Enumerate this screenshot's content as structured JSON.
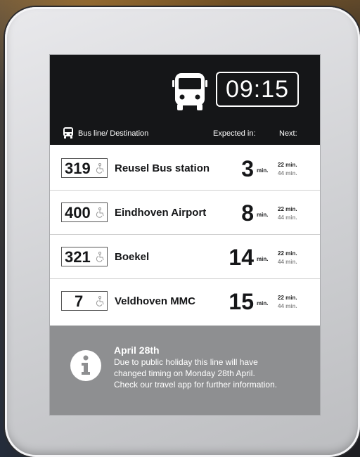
{
  "display": {
    "time": "09:15",
    "columns": {
      "line_destination": "Bus line/ Destination",
      "expected": "Expected in:",
      "next": "Next:"
    },
    "departures": [
      {
        "line": "319",
        "destination": "Reusel Bus station",
        "minutes": "3",
        "unit": "min.",
        "next": [
          "22 min.",
          "44 min."
        ]
      },
      {
        "line": "400",
        "destination": "Eindhoven Airport",
        "minutes": "8",
        "unit": "min.",
        "next": [
          "22 min.",
          "44 min."
        ]
      },
      {
        "line": "321",
        "destination": "Boekel",
        "minutes": "14",
        "unit": "min.",
        "next": [
          "22 min.",
          "44 min."
        ]
      },
      {
        "line": "7",
        "destination": "Veldhoven MMC",
        "minutes": "15",
        "unit": "min.",
        "next": [
          "22 min.",
          "44 min."
        ]
      }
    ],
    "notice": {
      "title": "April 28th",
      "lines": [
        "Due to public holiday this line will have",
        "changed timing on Monday 28th April.",
        "Check our travel app for further information."
      ]
    }
  },
  "icons": {
    "header": "bus-icon",
    "column": "bus-icon",
    "accessibility": "wheelchair-icon",
    "notice": "info-icon"
  },
  "colors": {
    "header_bg": "#151618",
    "notice_bg": "#8e8f91",
    "secondary_text": "#8d8d8d"
  }
}
